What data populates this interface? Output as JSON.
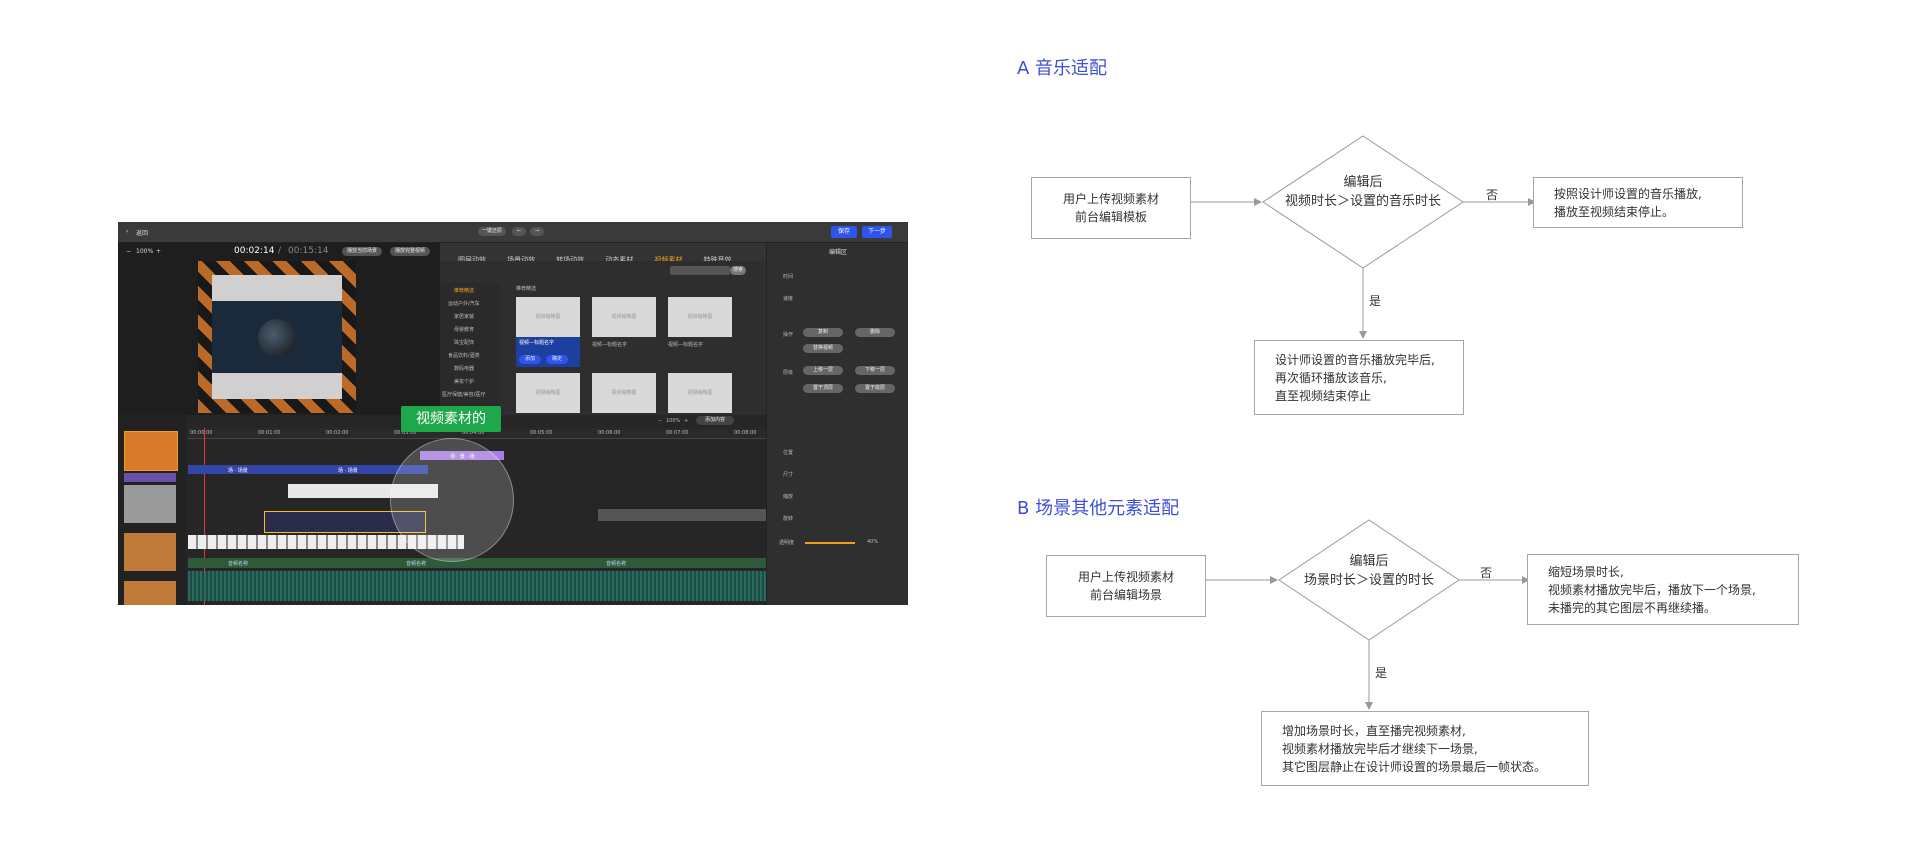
{
  "editor": {
    "back_label": "返回",
    "top_center_left": "一键还原",
    "save_label": "保存",
    "next_label": "下一步",
    "zoom": "100%",
    "time_current": "00:02:14",
    "time_total": "00:15:14",
    "preview_btn_1": "播放当前场景",
    "preview_btn_2": "播放完整视频",
    "tabs": [
      "图层动效",
      "场景动效",
      "转场动效",
      "动态素材",
      "视频素材",
      "特殊音效"
    ],
    "active_tab": "视频素材",
    "search_label": "搜索",
    "categories": [
      "推荐精选",
      "运动户外/汽车",
      "家居家装",
      "母婴教育",
      "珠宝配饰",
      "食品饮料/酒类",
      "数码电器",
      "美妆个护",
      "医疗保健/美容/医疗"
    ],
    "section_label": "推荐精选",
    "thumb_caption": "视频缩略图",
    "selected_thumb_title": "视频—标题名字",
    "thumb_titles": [
      "视频—标题名字",
      "视频—标题名字",
      "视频—标题名字"
    ],
    "thumb_add": "添加",
    "thumb_ok": "确定",
    "panel_title": "编辑区",
    "panel_labels": [
      "时间",
      "速度",
      "操作",
      "层级",
      "位置",
      "尺寸",
      "缩放",
      "旋转",
      "透明度"
    ],
    "panel_buttons": [
      "复制",
      "删除",
      "替换视频",
      "上移一层",
      "下移一层",
      "置于顶层",
      "置于底层"
    ],
    "opacity_value": "40%",
    "timeline_zoom": "100%",
    "add_content": "添加内容",
    "timeline_ticks": [
      "00:00:00",
      "00:01:00",
      "00:02:00",
      "00:03:00",
      "00:04:00",
      "00:05:00",
      "00:06:00",
      "00:07:00",
      "00:08:00"
    ],
    "track_label_1": "场 · 场景",
    "track_label_purple": "场 · 景 · 场",
    "audio_label": "音频名称",
    "callout": "视频素材的"
  },
  "flowA": {
    "title": "A 音乐适配",
    "start_box": [
      "用户上传视频素材",
      "前台编辑模板"
    ],
    "decision": [
      "编辑后",
      "视频时长＞设置的音乐时长"
    ],
    "no_label": "否",
    "yes_label": "是",
    "no_box": [
      "按照设计师设置的音乐播放,",
      "播放至视频结束停止。"
    ],
    "yes_box": [
      "设计师设置的音乐播放完毕后,",
      "再次循环播放该音乐,",
      "直至视频结束停止"
    ]
  },
  "flowB": {
    "title": "B 场景其他元素适配",
    "start_box": [
      "用户上传视频素材",
      "前台编辑场景"
    ],
    "decision": [
      "编辑后",
      "场景时长＞设置的时长"
    ],
    "no_label": "否",
    "yes_label": "是",
    "no_box": [
      "缩短场景时长,",
      "视频素材播放完毕后，播放下一个场景,",
      "未播完的其它图层不再继续播。"
    ],
    "yes_box": [
      "增加场景时长，直至播完视频素材,",
      "视频素材播放完毕后才继续下一场景,",
      "其它图层静止在设计师设置的场景最后一帧状态。"
    ]
  }
}
